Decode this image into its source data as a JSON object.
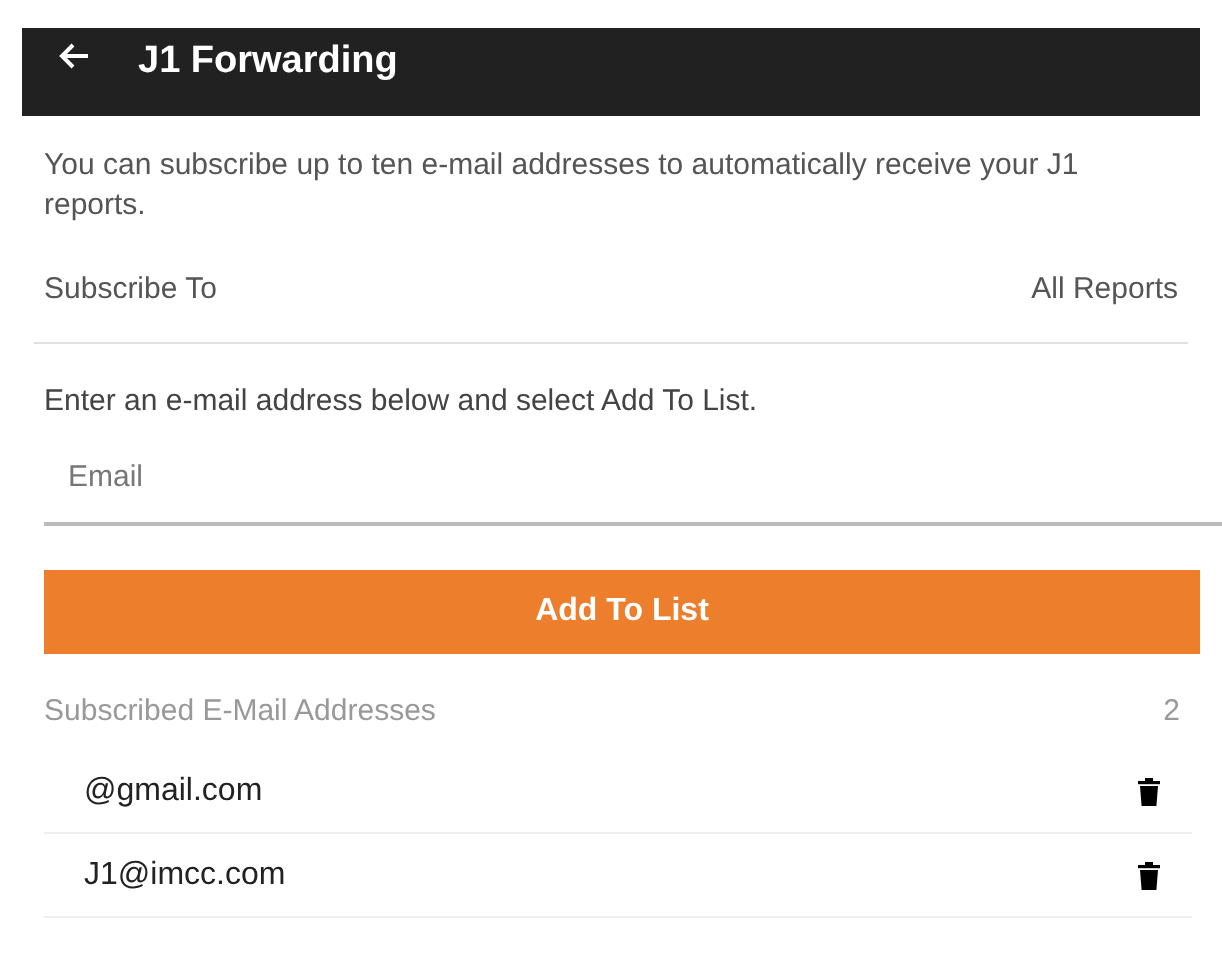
{
  "app_bar": {
    "title": "J1 Forwarding"
  },
  "intro": "You can subscribe up to ten e-mail addresses to automatically receive your J1 reports.",
  "subscribe_to": {
    "label": "Subscribe To",
    "value": "All Reports"
  },
  "instruction": "Enter an e-mail address below and select Add To List.",
  "email_field": {
    "placeholder": "Email"
  },
  "add_button": "Add To List",
  "subscribed": {
    "title": "Subscribed E-Mail Addresses",
    "count": "2",
    "items": [
      {
        "email": "@gmail.com"
      },
      {
        "email": "J1@imcc.com"
      }
    ]
  }
}
